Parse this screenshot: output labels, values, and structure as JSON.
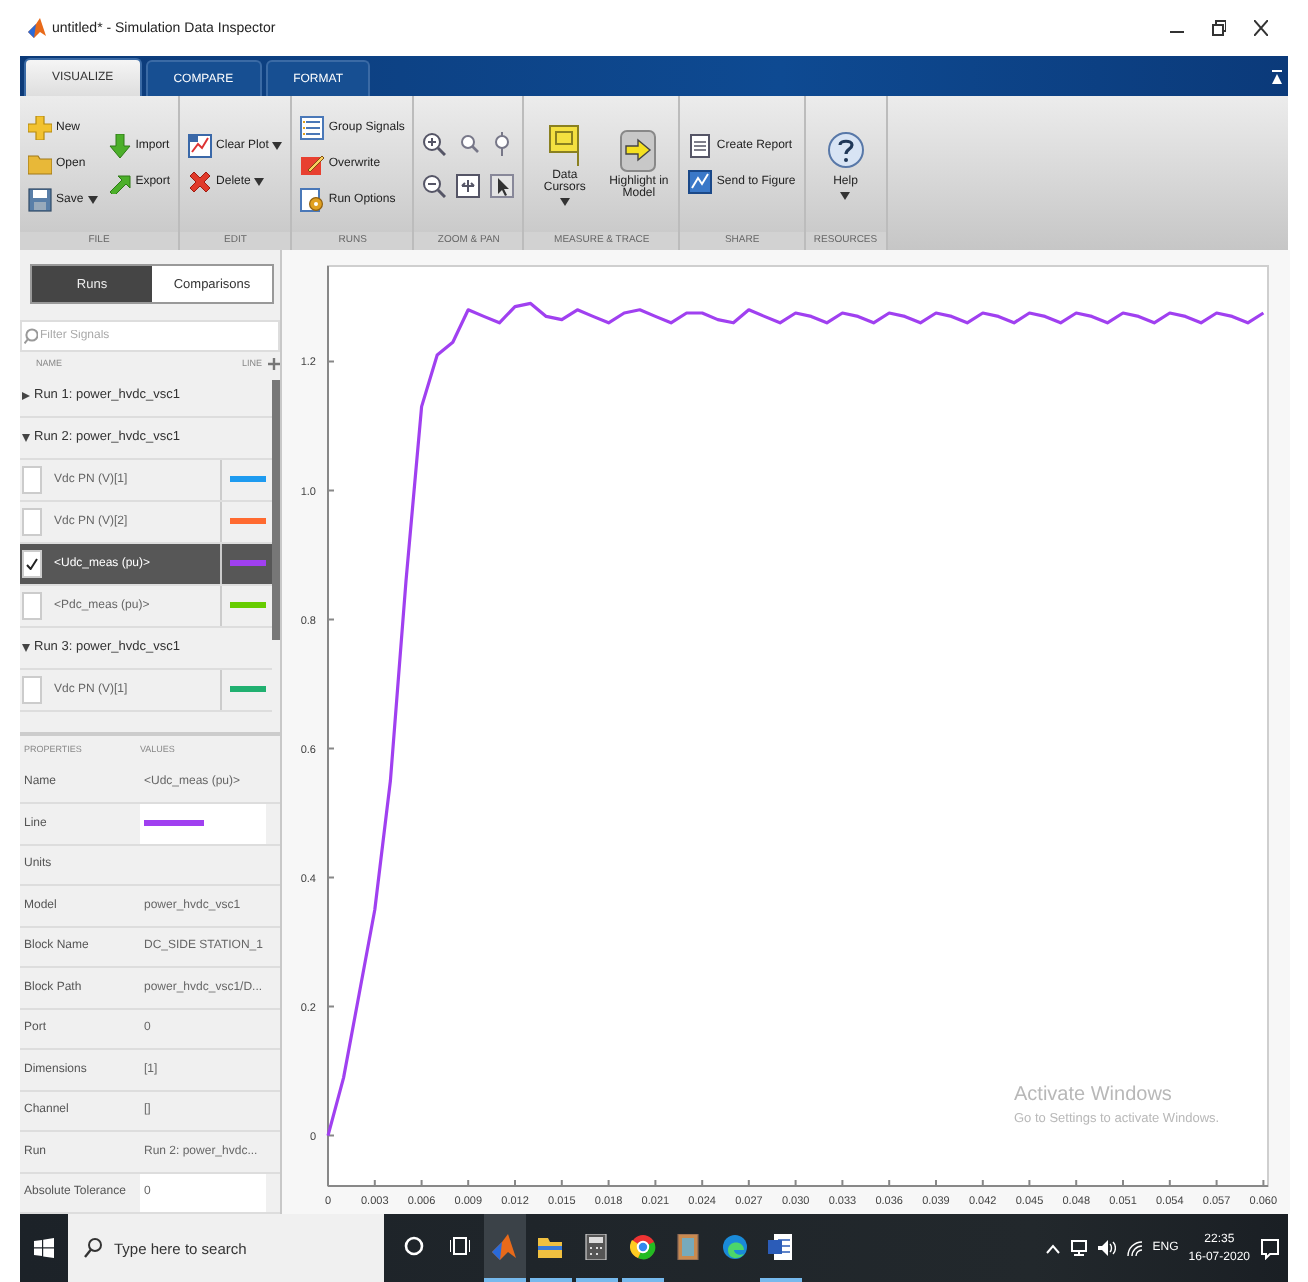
{
  "window": {
    "title": "untitled* - Simulation Data Inspector"
  },
  "tabs": [
    {
      "label": "VISUALIZE",
      "selected": true
    },
    {
      "label": "COMPARE",
      "selected": false
    },
    {
      "label": "FORMAT",
      "selected": false
    }
  ],
  "toolstrip": {
    "sections": [
      {
        "label": "FILE",
        "columns": [
          [
            {
              "label": "New",
              "kind": "small"
            },
            {
              "label": "Open",
              "kind": "small"
            },
            {
              "label": "Save",
              "kind": "small",
              "dropdown": true
            }
          ],
          [
            {
              "label": "Import",
              "kind": "small"
            },
            {
              "label": "Export",
              "kind": "small"
            }
          ]
        ]
      },
      {
        "label": "EDIT",
        "columns": [
          [
            {
              "label": "Clear Plot",
              "kind": "small",
              "dropdown": true
            },
            {
              "label": "Delete",
              "kind": "small",
              "dropdown": true
            }
          ]
        ]
      },
      {
        "label": "RUNS",
        "columns": [
          [
            {
              "label": "Group Signals",
              "kind": "small"
            },
            {
              "label": "Overwrite",
              "kind": "small"
            },
            {
              "label": "Run Options",
              "kind": "small"
            }
          ]
        ]
      },
      {
        "label": "ZOOM & PAN",
        "columns": [
          [
            {
              "kind": "icon"
            },
            {
              "kind": "icon"
            }
          ],
          [
            {
              "kind": "icon"
            },
            {
              "kind": "icon"
            }
          ],
          [
            {
              "kind": "icon"
            },
            {
              "kind": "icon"
            }
          ]
        ]
      },
      {
        "label": "MEASURE & TRACE",
        "columns": [
          [
            {
              "label": "Data Cursors",
              "kind": "large",
              "dropdown": true
            }
          ],
          [
            {
              "label": "Highlight in Model",
              "kind": "large"
            }
          ]
        ]
      },
      {
        "label": "SHARE",
        "columns": [
          [
            {
              "label": "Create Report",
              "kind": "small"
            },
            {
              "label": "Send to Figure",
              "kind": "small"
            }
          ]
        ]
      },
      {
        "label": "RESOURCES",
        "columns": [
          [
            {
              "label": "Help",
              "kind": "large",
              "dropdown": true
            }
          ]
        ]
      }
    ]
  },
  "left_panel": {
    "view_toggle": [
      {
        "label": "Runs",
        "selected": true
      },
      {
        "label": "Comparisons",
        "selected": false
      }
    ],
    "filter": {
      "placeholder": "Filter Signals"
    },
    "columns": [
      "NAME",
      "LINE"
    ],
    "runs": [
      {
        "label": "Run 1: power_hvdc_vsc1",
        "expanded": false
      },
      {
        "label": "Run 2: power_hvdc_vsc1",
        "expanded": true,
        "children": [
          {
            "label": "Vdc PN (V)[1]",
            "checked": false,
            "selected": false,
            "color": "#1e9bf0"
          },
          {
            "label": "Vdc PN (V)[2]",
            "checked": false,
            "selected": false,
            "color": "#ff6a30"
          },
          {
            "label": "<Udc_meas (pu)>",
            "checked": true,
            "selected": true,
            "color": "#a040f0"
          },
          {
            "label": "<Pdc_meas (pu)>",
            "checked": false,
            "selected": false,
            "color": "#66cc00"
          }
        ]
      },
      {
        "label": "Run 3: power_hvdc_vsc1",
        "expanded": true,
        "children": [
          {
            "label": "Vdc PN (V)[1]",
            "checked": false,
            "selected": false,
            "color": "#20b070"
          }
        ]
      }
    ]
  },
  "properties": {
    "columns": [
      "PROPERTIES",
      "VALUES"
    ],
    "rows": [
      {
        "name": "Name",
        "value": "<Udc_meas (pu)>"
      },
      {
        "name": "Line",
        "kind": "line",
        "color": "#a040f0",
        "editable": true
      },
      {
        "name": "Units"
      },
      {
        "name": "Model",
        "value": "power_hvdc_vsc1"
      },
      {
        "name": "Block Name",
        "value": "DC_SIDE STATION_1"
      },
      {
        "name": "Block Path",
        "value": "power_hvdc_vsc1/D..."
      },
      {
        "name": "Port",
        "value": "0"
      },
      {
        "name": "Dimensions",
        "value": "[1]"
      },
      {
        "name": "Channel",
        "value": "[]"
      },
      {
        "name": "Run",
        "value": "Run 2: power_hvdc..."
      },
      {
        "name": "Absolute Tolerance",
        "value": "0",
        "editable": true
      }
    ]
  },
  "plot": {
    "chart_data": {
      "type": "line",
      "xlim": [
        0,
        0.0603
      ],
      "ylim": [
        -0.078,
        1.348
      ],
      "x": [
        0,
        0.001,
        0.002,
        0.003,
        0.004,
        0.005,
        0.006,
        0.007,
        0.008,
        0.009,
        0.01,
        0.011,
        0.012,
        0.013,
        0.014,
        0.015,
        0.016,
        0.017,
        0.018,
        0.019,
        0.02,
        0.021,
        0.022,
        0.023,
        0.024,
        0.025,
        0.026,
        0.027,
        0.028,
        0.029,
        0.03,
        0.031,
        0.032,
        0.033,
        0.034,
        0.035,
        0.036,
        0.037,
        0.038,
        0.039,
        0.04,
        0.041,
        0.042,
        0.043,
        0.044,
        0.045,
        0.046,
        0.047,
        0.048,
        0.049,
        0.05,
        0.051,
        0.052,
        0.053,
        0.054,
        0.055,
        0.056,
        0.057,
        0.058,
        0.059,
        0.06
      ],
      "series": [
        {
          "color": "#a040f0",
          "values": [
            0,
            0.09,
            0.22,
            0.35,
            0.55,
            0.86,
            1.13,
            1.21,
            1.23,
            1.28,
            1.27,
            1.26,
            1.285,
            1.29,
            1.27,
            1.265,
            1.28,
            1.27,
            1.26,
            1.275,
            1.28,
            1.27,
            1.26,
            1.275,
            1.275,
            1.265,
            1.26,
            1.28,
            1.27,
            1.26,
            1.275,
            1.27,
            1.26,
            1.275,
            1.27,
            1.26,
            1.275,
            1.27,
            1.26,
            1.275,
            1.27,
            1.26,
            1.275,
            1.27,
            1.26,
            1.275,
            1.27,
            1.26,
            1.275,
            1.27,
            1.26,
            1.275,
            1.27,
            1.26,
            1.275,
            1.27,
            1.26,
            1.275,
            1.27,
            1.26,
            1.275
          ]
        }
      ],
      "xticks": [
        {
          "value": 0,
          "label": "0"
        },
        {
          "value": 0.003,
          "label": "0.003"
        },
        {
          "value": 0.006,
          "label": "0.006"
        },
        {
          "value": 0.009,
          "label": "0.009"
        },
        {
          "value": 0.012,
          "label": "0.012"
        },
        {
          "value": 0.015,
          "label": "0.015"
        },
        {
          "value": 0.018,
          "label": "0.018"
        },
        {
          "value": 0.021,
          "label": "0.021"
        },
        {
          "value": 0.024,
          "label": "0.024"
        },
        {
          "value": 0.027,
          "label": "0.027"
        },
        {
          "value": 0.03,
          "label": "0.030"
        },
        {
          "value": 0.033,
          "label": "0.033"
        },
        {
          "value": 0.036,
          "label": "0.036"
        },
        {
          "value": 0.039,
          "label": "0.039"
        },
        {
          "value": 0.042,
          "label": "0.042"
        },
        {
          "value": 0.045,
          "label": "0.045"
        },
        {
          "value": 0.048,
          "label": "0.048"
        },
        {
          "value": 0.051,
          "label": "0.051"
        },
        {
          "value": 0.054,
          "label": "0.054"
        },
        {
          "value": 0.057,
          "label": "0.057"
        },
        {
          "value": 0.06,
          "label": "0.060"
        }
      ],
      "yticks": [
        {
          "value": 0,
          "label": "0"
        },
        {
          "value": 0.2,
          "label": "0.2"
        },
        {
          "value": 0.4,
          "label": "0.4"
        },
        {
          "value": 0.6,
          "label": "0.6"
        },
        {
          "value": 0.8,
          "label": "0.8"
        },
        {
          "value": 1,
          "label": "1.0"
        },
        {
          "value": 1.2,
          "label": "1.2"
        }
      ]
    },
    "activation_notice": {
      "title": "Activate Windows",
      "subtitle": "Go to Settings to activate Windows."
    }
  },
  "taskbar": {
    "search": {
      "placeholder": "Type here to search"
    },
    "apps": [
      {
        "running": true,
        "selected": true
      },
      {
        "running": true,
        "selected": false
      },
      {
        "running": true,
        "selected": false
      },
      {
        "running": true,
        "selected": false
      },
      {
        "running": false,
        "selected": false
      },
      {
        "running": false,
        "selected": false
      },
      {
        "running": true,
        "selected": false
      }
    ],
    "language": "ENG",
    "time": "22:35",
    "date": "16-07-2020"
  }
}
